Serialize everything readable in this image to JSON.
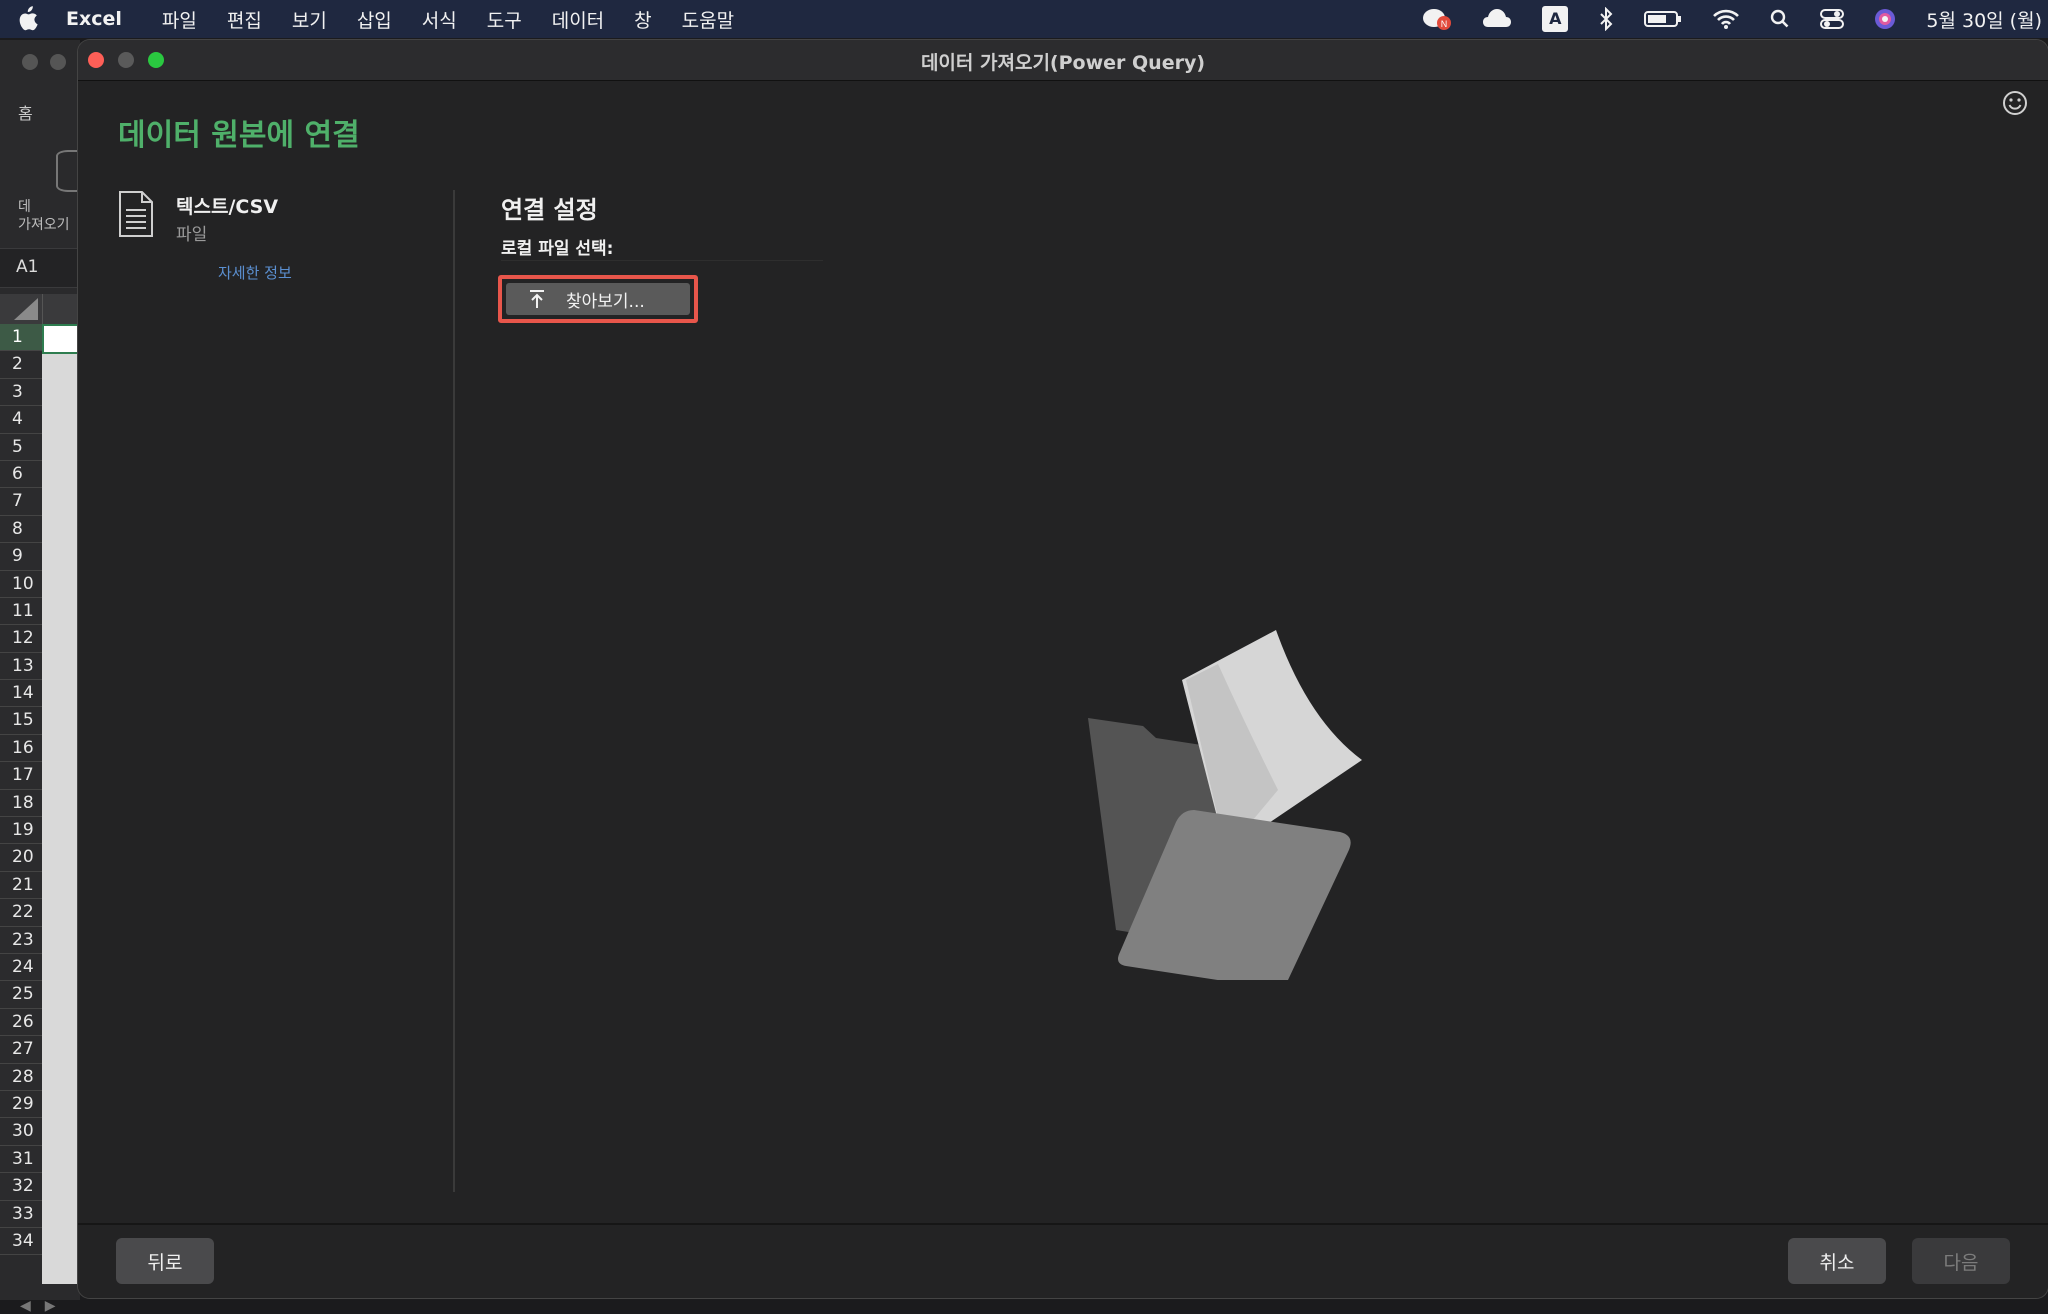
{
  "menubar": {
    "app_name": "Excel",
    "menus": [
      "파일",
      "편집",
      "보기",
      "삽입",
      "서식",
      "도구",
      "데이터",
      "창",
      "도움말"
    ],
    "input_indicator": "A",
    "date": "5월 30일 (월)"
  },
  "excel": {
    "tab_home": "홈",
    "get_data_label": "데\n가져오기",
    "cell_ref": "A1",
    "rows": [
      "1",
      "2",
      "3",
      "4",
      "5",
      "6",
      "7",
      "8",
      "9",
      "10",
      "11",
      "12",
      "13",
      "14",
      "15",
      "16",
      "17",
      "18",
      "19",
      "20",
      "21",
      "22",
      "23",
      "24",
      "25",
      "26",
      "27",
      "28",
      "29",
      "30",
      "31",
      "32",
      "33",
      "34"
    ]
  },
  "dialog": {
    "title": "데이터 가져오기(Power Query)",
    "heading": "데이터 원본에 연결",
    "source": {
      "name": "텍스트/CSV",
      "type": "파일",
      "more_info": "자세한 정보"
    },
    "settings": {
      "title": "연결 설정",
      "local_file_label": "로컬 파일 선택:",
      "browse_label": "찾아보기..."
    },
    "footer": {
      "back_label": "뒤로",
      "cancel_label": "취소",
      "next_label": "다음"
    }
  },
  "colors": {
    "accent_green": "#4fb06a",
    "highlight_red": "#e8564b",
    "link_blue": "#5b8fd0"
  }
}
